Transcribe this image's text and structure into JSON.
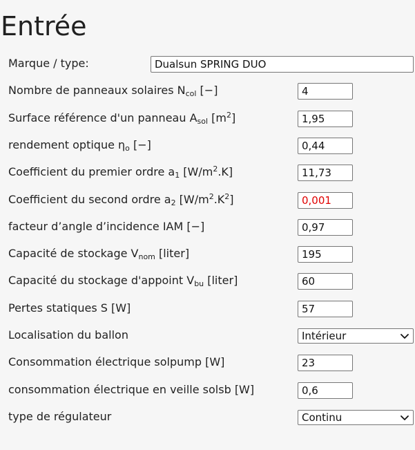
{
  "page": {
    "title": "Entrée"
  },
  "form": {
    "brand": {
      "label": "Marque / type:",
      "value": "Dualsun SPRING DUO"
    },
    "n_panels": {
      "label_main": "Nombre de panneaux solaires N",
      "label_sub": "col",
      "label_tail": " [−]",
      "value": "4"
    },
    "panel_area": {
      "label_main": "Surface référence d'un panneau A",
      "label_sub": "sol",
      "label_mid": " [m",
      "label_sup": "2",
      "label_tail": "]",
      "value": "1,95"
    },
    "optical_eff": {
      "label_main": "rendement optique η",
      "label_sub": "o",
      "label_tail": " [−]",
      "value": "0,44"
    },
    "coef_a1": {
      "label_main": "Coefficient du premier ordre a",
      "label_sub": "1",
      "label_mid": " [W/m",
      "label_sup": "2",
      "label_tail": ".K]",
      "value": "11,73"
    },
    "coef_a2": {
      "label_main": "Coefficient du second ordre a",
      "label_sub": "2",
      "label_mid": " [W/m",
      "label_sup1": "2",
      "label_mid2": ".K",
      "label_sup2": "2",
      "label_tail": "]",
      "value": "0,001",
      "value_color": "#e00000"
    },
    "iam": {
      "label": "facteur d’angle d’incidence IAM [−]",
      "value": "0,97"
    },
    "storage_cap": {
      "label_main": "Capacité de stockage V",
      "label_sub": "nom",
      "label_tail": " [liter]",
      "value": "195"
    },
    "backup_cap": {
      "label_main": "Capacité du stockage d'appoint V",
      "label_sub": "bu",
      "label_tail": " [liter]",
      "value": "60"
    },
    "static_losses": {
      "label": "Pertes statiques S [W]",
      "value": "57"
    },
    "tank_location": {
      "label": "Localisation du ballon",
      "selected": "Intérieur"
    },
    "solpump": {
      "label": "Consommation électrique solpump [W]",
      "value": "23"
    },
    "standby": {
      "label": "consommation électrique en veille solsb [W]",
      "value": "0,6"
    },
    "regulator": {
      "label": "type de régulateur",
      "selected": "Continu"
    }
  }
}
